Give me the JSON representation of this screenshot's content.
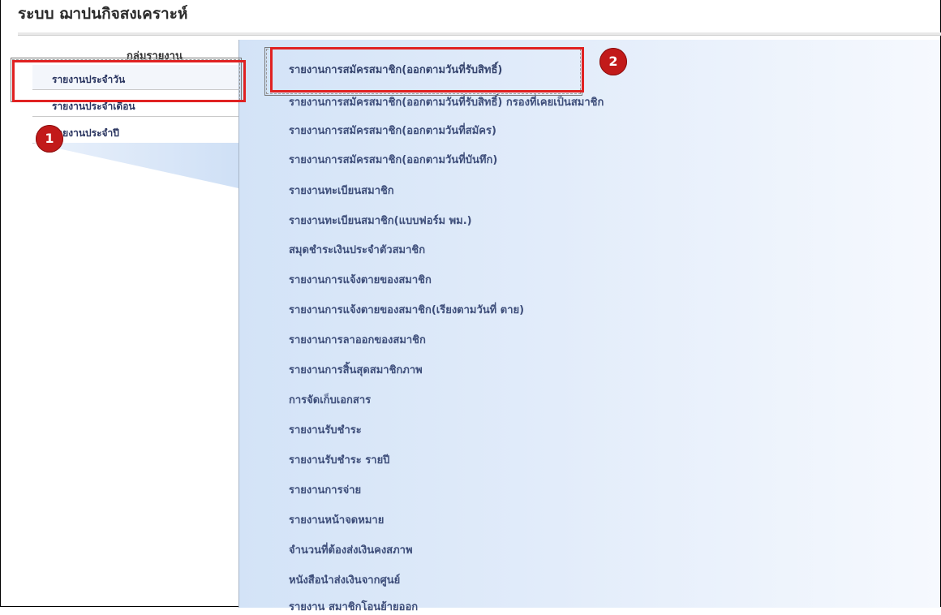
{
  "app": {
    "title": "ระบบ ฌาปนกิจสงเคราะห์"
  },
  "sidebar": {
    "header": "กลุ่มรายงาน",
    "items": [
      {
        "label": "รายงานประจำวัน",
        "active": true
      },
      {
        "label": "รายงานประจำเดือน",
        "active": false
      },
      {
        "label": "รายงานประจำปี",
        "active": false
      }
    ]
  },
  "reports": [
    "รายงานการสมัครสมาชิก(ออกตามวันที่รับสิทธิ์)",
    "รายงานการสมัครสมาชิก(ออกตามวันที่รับสิทธิ์) กรองที่เคยเป็นสมาชิก",
    "รายงานการสมัครสมาชิก(ออกตามวันที่สมัคร)",
    "รายงานการสมัครสมาชิก(ออกตามวันที่บันทึก)",
    "รายงานทะเบียนสมาชิก",
    "รายงานทะเบียนสมาชิก(แบบฟอร์ม พม.)",
    "สมุดชำระเงินประจำตัวสมาชิก",
    "รายงานการแจ้งตายของสมาชิก",
    "รายงานการแจ้งตายของสมาชิก(เรียงตามวันที่ ตาย)",
    "รายงานการลาออกของสมาชิก",
    "รายงานการสิ้นสุดสมาชิกภาพ",
    "การจัดเก็บเอกสาร",
    "รายงานรับชำระ",
    "รายงานรับชำระ รายปี",
    "รายงานการจ่าย",
    "รายงานหน้าจดหมาย",
    "จำนวนที่ต้องส่งเงินคงสภาพ",
    "หนังสือนำส่งเงินจากศูนย์",
    "รายงาน สมาชิกโอนย้ายออก"
  ],
  "annotations": {
    "badge1": "1",
    "badge2": "2"
  },
  "colors": {
    "highlight": "#e02222",
    "badge": "#c21a1a",
    "link": "#3e4e7a"
  }
}
